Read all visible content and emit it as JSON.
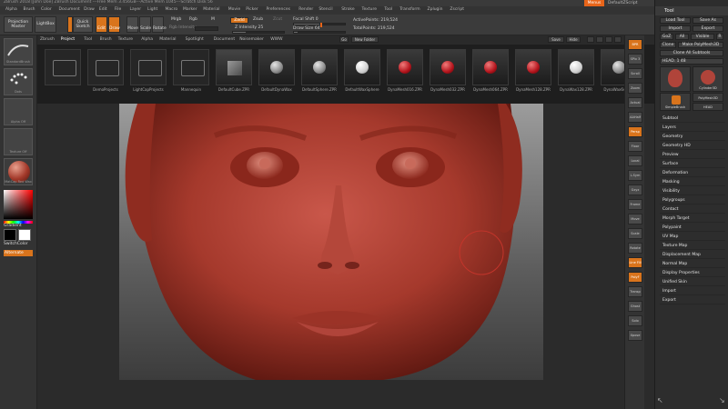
{
  "titlebar": {
    "title": "ZBrush 2018 [John Doe] ZBrush Document   ---Free Mem 3.456GB---Active Mem 1045---Scratch Disk 56",
    "menus_btn": "Menus",
    "script": "DefaultZScript"
  },
  "menu": [
    "Alpha",
    "Brush",
    "Color",
    "Document",
    "Draw",
    "Edit",
    "File",
    "Layer",
    "Light",
    "Macro",
    "Marker",
    "Material",
    "Movie",
    "Picker",
    "Preferences",
    "Render",
    "Stencil",
    "Stroke",
    "Texture",
    "Tool",
    "Transform",
    "Zplugin",
    "Zscript"
  ],
  "shelf": {
    "projection_master": "Projection Master",
    "lightbox": "LightBox",
    "quick_sketch": "Quick Sketch",
    "edit": "Edit",
    "draw": "Draw",
    "move": "Move",
    "scale": "Scale",
    "rotate": "Rotate",
    "mrgb": "Mrgb",
    "rgb": "Rgb",
    "m": "M",
    "rgb_intensity": "Rgb Intensity",
    "zadd": "Zadd",
    "zsub": "Zsub",
    "zcut": "Zcut",
    "z_intensity": "Z Intensity 25",
    "focal_shift": "Focal Shift 0",
    "draw_size": "Draw Size 64",
    "active_points": "ActivePoints: 219,524",
    "total_points": "TotalPoints: 219,524",
    "z_intensity_value": 25,
    "focal_shift_value": 0,
    "draw_size_value": 64
  },
  "left": {
    "tiles": [
      "StandardBrush",
      "Dots",
      "Alpha Off",
      "Texture Off",
      "MatCap Red Wax"
    ],
    "gradient": "Gradient",
    "switch_color": "SwitchColor",
    "alternate": "Alternate"
  },
  "lightbox": {
    "tabs": [
      "Zbrush",
      "Project",
      "Tool",
      "Brush",
      "Texture",
      "Alpha",
      "Material",
      "Spotlight",
      "Document",
      "Noisemaker",
      "WWW"
    ],
    "active_tab": "Project",
    "btn_go": "Go",
    "btn_new_folder": "New Folder",
    "btn_save": "Save",
    "btn_hide": "Hide",
    "items": [
      {
        "label": "",
        "type": "folder"
      },
      {
        "label": "DemoProjects",
        "type": "folder"
      },
      {
        "label": "LightCapProjects",
        "type": "folder"
      },
      {
        "label": "Mannequin",
        "type": "folder"
      },
      {
        "label": "DefaultCube.ZPR",
        "type": "cube"
      },
      {
        "label": "DefaultDynaWax",
        "type": "grey"
      },
      {
        "label": "DefaultSphere.ZPR",
        "type": "grey"
      },
      {
        "label": "DefaultWaxSphere",
        "type": "white"
      },
      {
        "label": "DynaMesh016.ZPR",
        "type": "red"
      },
      {
        "label": "DynaMesh032.ZPR",
        "type": "red"
      },
      {
        "label": "DynaMesh064.ZPR",
        "type": "red"
      },
      {
        "label": "DynaMesh128.ZPR",
        "type": "red"
      },
      {
        "label": "DynaWax128.ZPR",
        "type": "white"
      },
      {
        "label": "DynaWax64.ZPR",
        "type": "grey"
      }
    ]
  },
  "right_shelf": [
    "BPR",
    "SPix 3",
    "Scroll",
    "Zoom",
    "Actual",
    "AAHalf",
    "Persp",
    "Floor",
    "Local",
    "L.Sym",
    "Gxyz",
    "Frame",
    "Move",
    "Scale",
    "Rotate",
    "Line Fill",
    "PolyF",
    "Transp",
    "Ghost",
    "Solo",
    "Xpose"
  ],
  "tool": {
    "title": "Tool",
    "load_tool": "Load Tool",
    "save_as": "Save As",
    "import": "Import",
    "export": "Export",
    "goz": "GoZ",
    "all": "All",
    "visible": "Visible",
    "r": "R",
    "clone": "Clone",
    "make_polymesh": "Make PolyMesh3D",
    "clone_all": "Clone All Subtools",
    "head": "HEAD. 1  48",
    "tools": [
      "HEAD",
      "Cylinder3D",
      "PolyMesh3D",
      "SimpleBrush",
      "HEAD"
    ],
    "sections": [
      "Subtool",
      "Layers",
      "Geometry",
      "Geometry HD",
      "Preview",
      "Surface",
      "Deformation",
      "Masking",
      "Visibility",
      "Polygroups",
      "Contact",
      "Morph Target",
      "Polypaint",
      "UV Map",
      "Texture Map",
      "Displacement Map",
      "Normal Map",
      "Display Properties",
      "Unified Skin",
      "Import",
      "Export"
    ]
  }
}
